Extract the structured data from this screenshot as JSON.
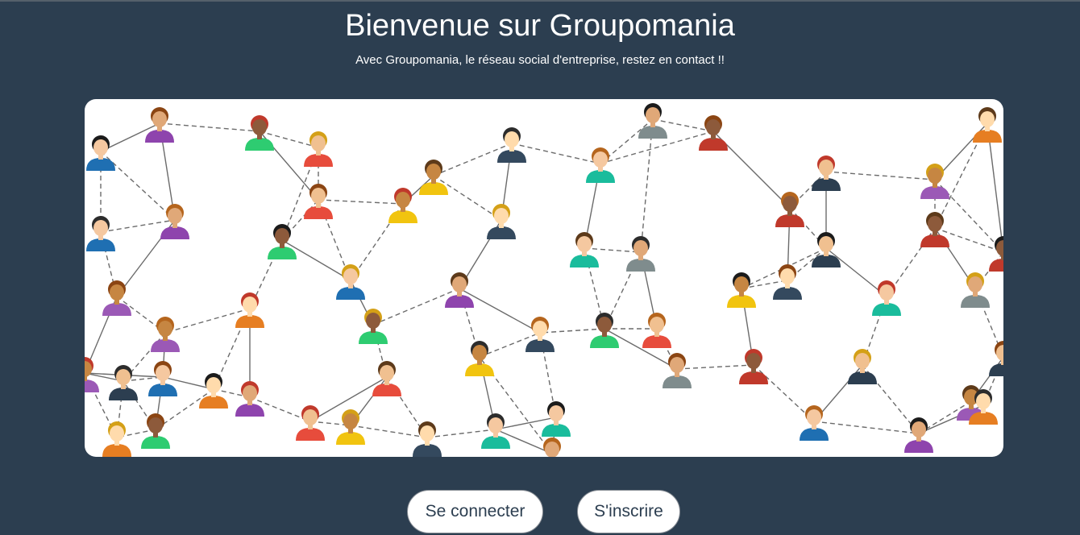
{
  "header": {
    "title": "Bienvenue sur Groupomania",
    "subtitle": "Avec Groupomania, le réseau social d'entreprise, restez en contact !!"
  },
  "hero": {
    "image_icon": "people-network-illustration"
  },
  "actions": {
    "login_label": "Se connecter",
    "signup_label": "S'inscrire"
  },
  "colors": {
    "background": "#2c3e50",
    "button_bg": "#ffffff",
    "button_text": "#2c3e50",
    "hero_bg": "#ffffff"
  }
}
